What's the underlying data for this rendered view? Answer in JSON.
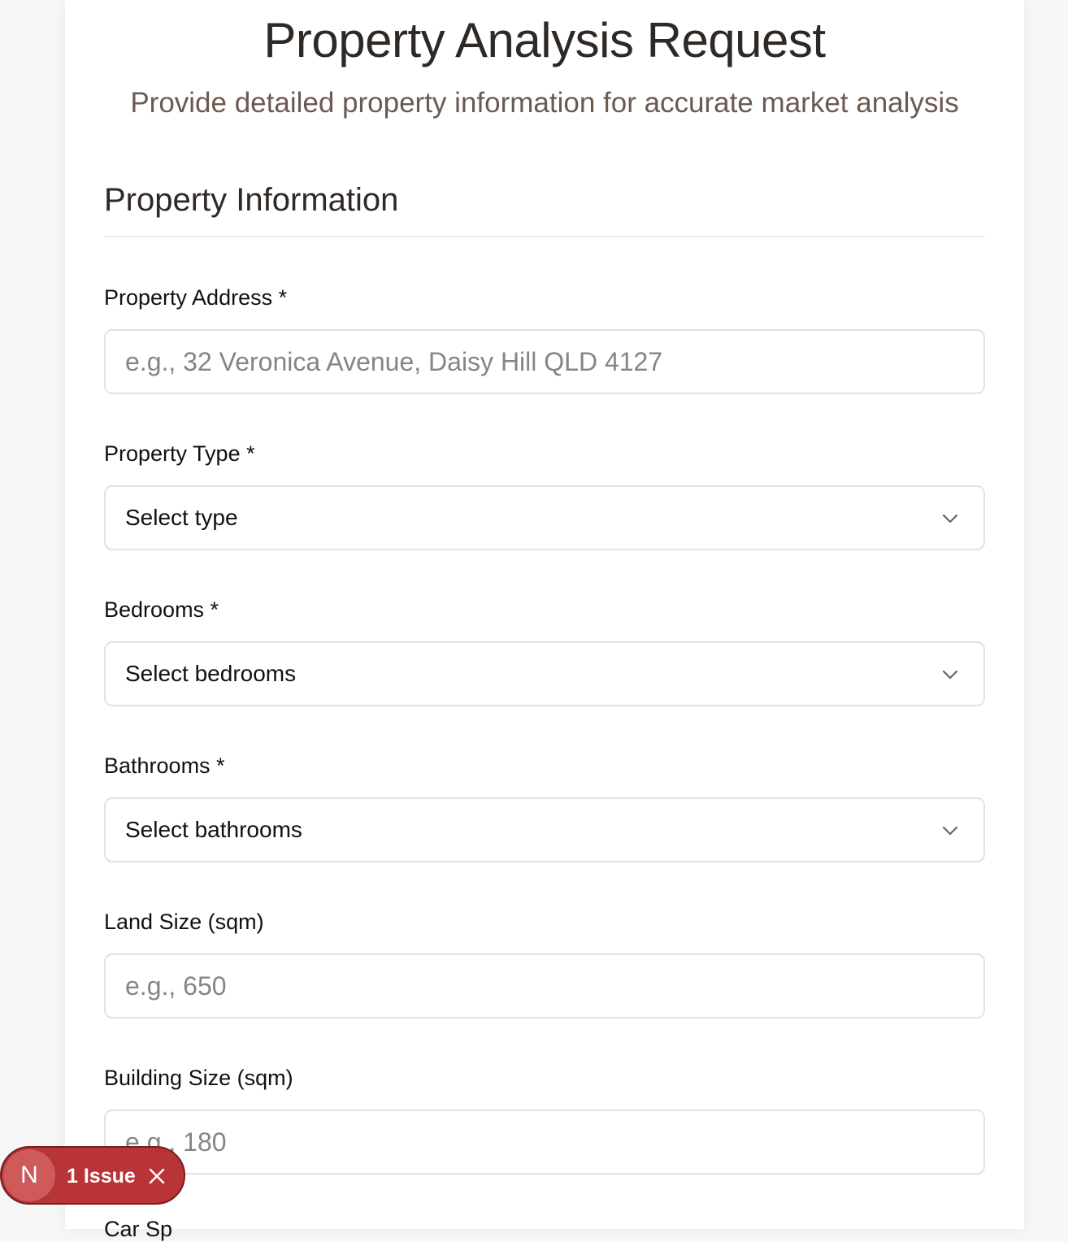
{
  "header": {
    "title": "Property Analysis Request",
    "subtitle": "Provide detailed property information for accurate market analysis"
  },
  "section": {
    "title": "Property Information"
  },
  "fields": {
    "address": {
      "label": "Property Address *",
      "placeholder": "e.g., 32 Veronica Avenue, Daisy Hill QLD 4127",
      "value": ""
    },
    "property_type": {
      "label": "Property Type *",
      "selected": "Select type",
      "icon": "chevron-down-icon"
    },
    "bedrooms": {
      "label": "Bedrooms *",
      "selected": "Select bedrooms",
      "icon": "chevron-down-icon"
    },
    "bathrooms": {
      "label": "Bathrooms *",
      "selected": "Select bathrooms",
      "icon": "chevron-down-icon"
    },
    "land_size": {
      "label": "Land Size (sqm)",
      "placeholder": "e.g., 650",
      "value": ""
    },
    "building_size": {
      "label": "Building Size (sqm)",
      "placeholder": "e.g., 180",
      "value": ""
    },
    "next_label_partial": "Car Sp"
  },
  "issue_badge": {
    "logo_letter": "N",
    "text": "1 Issue",
    "close_icon": "close-icon"
  },
  "colors": {
    "title": "#2f2926",
    "subtitle": "#6b5a50",
    "badge": "#b83437",
    "border": "#e2e2e2"
  }
}
